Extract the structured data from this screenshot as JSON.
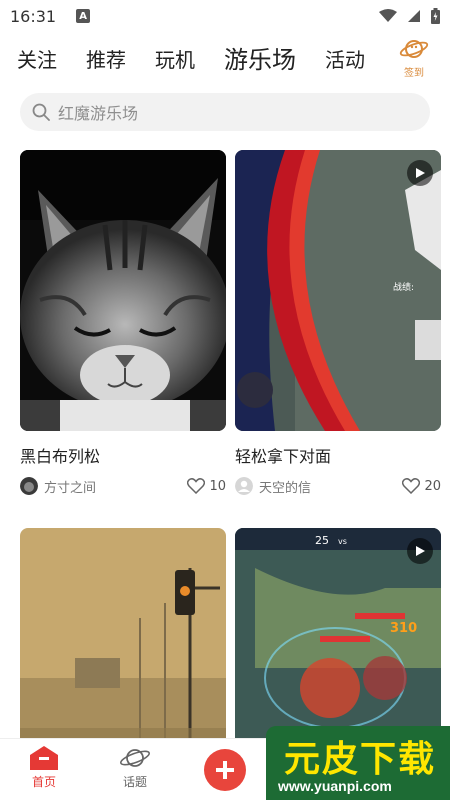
{
  "status_bar": {
    "time": "16:31",
    "a_badge": "A"
  },
  "tabs": [
    {
      "label": "关注"
    },
    {
      "label": "推荐"
    },
    {
      "label": "玩机"
    },
    {
      "label": "游乐场"
    },
    {
      "label": "活动"
    }
  ],
  "checkin": {
    "label": "签到"
  },
  "search": {
    "placeholder": "红魔游乐场"
  },
  "cards": [
    {
      "title": "黑白布列松",
      "author": "方寸之间",
      "likes": "10",
      "video": false
    },
    {
      "title": "轻松拿下对面",
      "author": "天空的信",
      "likes": "20",
      "video": true
    },
    {
      "title": "",
      "author": "",
      "likes": "",
      "video": false
    },
    {
      "title": "",
      "author": "",
      "likes": "",
      "video": true
    }
  ],
  "game_overlay": {
    "left_text": "战绩:",
    "score": "25",
    "vs": "vs",
    "num": "310"
  },
  "bottom_nav": {
    "home": "首页",
    "topics": "话题"
  },
  "watermark": {
    "title": "元皮下载",
    "url": "www.yuanpi.com"
  },
  "colors": {
    "accent": "#e8453c",
    "checkin": "#d98a3a",
    "watermark_bg": "#1d6b34",
    "watermark_text": "#ffe600"
  }
}
